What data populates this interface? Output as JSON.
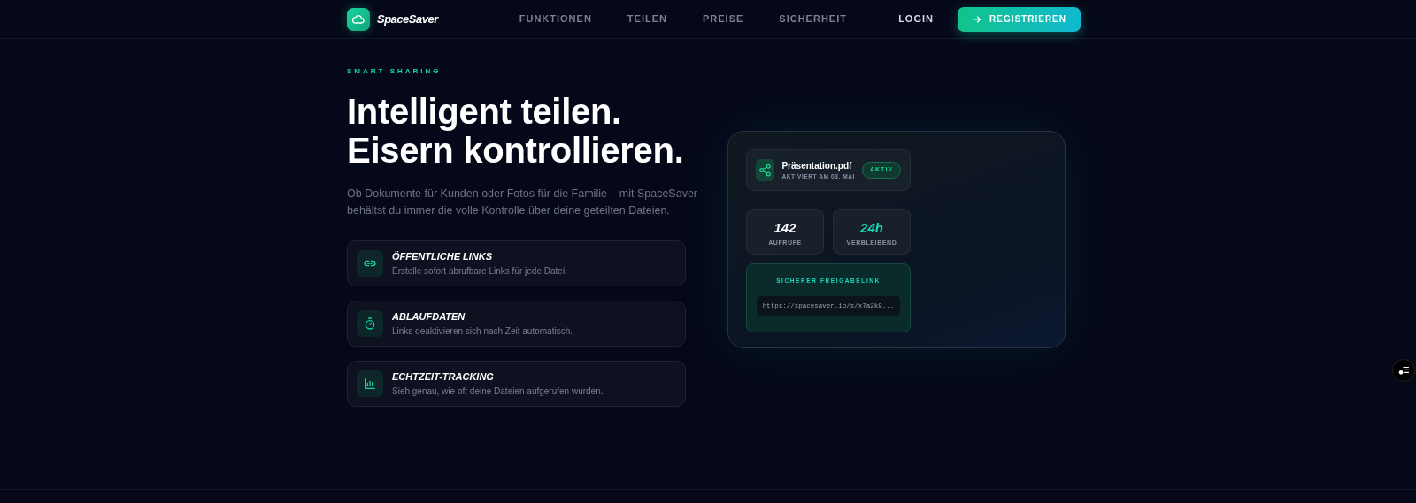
{
  "navbar": {
    "brand": "SpaceSaver",
    "links": [
      "FUNKTIONEN",
      "TEILEN",
      "PREISE",
      "SICHERHEIT"
    ],
    "login": "LOGIN",
    "register": "REGISTRIEREN"
  },
  "hero": {
    "eyebrow": "SMART SHARING",
    "headline": [
      "Intelligent teilen.",
      "Eisern kontrollieren."
    ],
    "lead": "Ob Dokumente für Kunden oder Fotos für die Familie – mit SpaceSaver behältst du immer die volle Kontrolle über deine geteilten Dateien.",
    "features": [
      {
        "title": "ÖFFENTLICHE LINKS",
        "text": "Erstelle sofort abrufbare Links für jede Datei."
      },
      {
        "title": "ABLAUFDATEN",
        "text": "Links deaktivieren sich nach Zeit automatisch."
      },
      {
        "title": "ECHTZEIT-TRACKING",
        "text": "Sieh genau, wie oft deine Dateien aufgerufen wurden."
      }
    ]
  },
  "preview": {
    "file": {
      "name": "Präsentation.pdf",
      "meta": "AKTIVIERT AM 03. MAI",
      "status": "AKTIV"
    },
    "stats": [
      {
        "value": "142",
        "label": "AUFRUFE",
        "accent": false
      },
      {
        "value": "24h",
        "label": "VERBLEIBEND",
        "accent": true
      }
    ],
    "link": {
      "label": "SICHERER FREIGABELINK",
      "url": "https://spacesaver.io/s/x7a2k9..."
    }
  }
}
